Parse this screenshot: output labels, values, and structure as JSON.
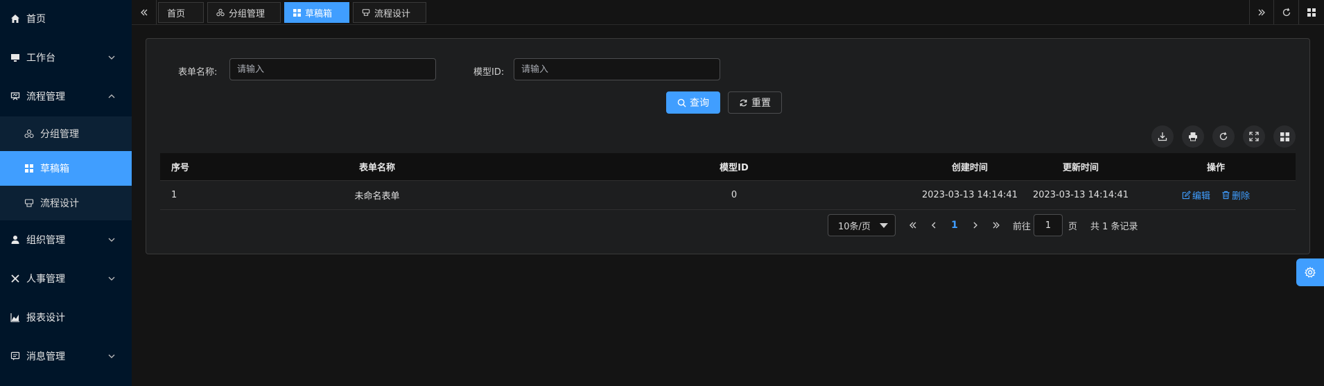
{
  "sidebar": {
    "items": [
      {
        "label": "首页",
        "icon": "home-icon"
      },
      {
        "label": "工作台",
        "icon": "monitor-icon"
      },
      {
        "label": "流程管理",
        "icon": "flow-icon"
      },
      {
        "label": "组织管理",
        "icon": "user-icon"
      },
      {
        "label": "人事管理",
        "icon": "close-x-icon"
      },
      {
        "label": "报表设计",
        "icon": "chart-icon"
      },
      {
        "label": "消息管理",
        "icon": "message-icon"
      }
    ],
    "submenu": [
      {
        "label": "分组管理",
        "icon": "cluster-icon"
      },
      {
        "label": "草稿箱",
        "icon": "grid-icon"
      },
      {
        "label": "流程设计",
        "icon": "design-icon"
      }
    ]
  },
  "tabs": [
    {
      "label": "首页"
    },
    {
      "label": "分组管理"
    },
    {
      "label": "草稿箱"
    },
    {
      "label": "流程设计"
    }
  ],
  "search": {
    "form_name_label": "表单名称:",
    "form_name_placeholder": "请输入",
    "model_id_label": "模型ID:",
    "model_id_placeholder": "请输入",
    "query_label": "查询",
    "reset_label": "重置"
  },
  "table": {
    "headers": [
      "序号",
      "表单名称",
      "模型ID",
      "创建时间",
      "更新时间",
      "操作"
    ],
    "rows": [
      {
        "index": "1",
        "name": "未命名表单",
        "model_id": "0",
        "created": "2023-03-13 14:14:41",
        "updated": "2023-03-13 14:14:41"
      }
    ],
    "edit_label": "编辑",
    "delete_label": "删除"
  },
  "pagination": {
    "page_size": "10条/页",
    "current_page": "1",
    "goto_label": "前往",
    "goto_value": "1",
    "page_unit": "页",
    "total_text": "共 1 条记录"
  },
  "colors": {
    "accent": "#409eff",
    "sidebar_bg": "#001529"
  }
}
